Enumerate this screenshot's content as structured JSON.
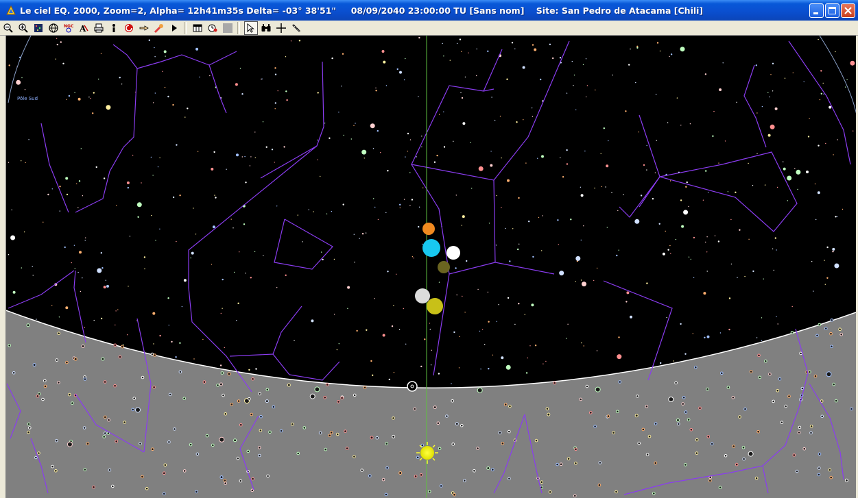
{
  "window": {
    "title": "Le ciel EQ. 2000, Zoom=2, Alpha= 12h41m35s Delta= -03° 38'51\"     08/09/2040 23:00:00 TU [Sans nom]    Site: San Pedro de Atacama [Chili]"
  },
  "toolbar": {
    "buttons": [
      "zoom-out-icon",
      "zoom-in-icon",
      "star-map-icon",
      "globe-icon",
      "ngc-icon",
      "text-label-icon",
      "print-icon",
      "info-icon",
      "reset-icon",
      "pointer-hand-icon",
      "comet-icon",
      "play-icon",
      "calendar-icon",
      "time-icon",
      "stop-icon",
      "arrow-cursor-icon",
      "binoculars-icon",
      "crosshair-icon",
      "measure-icon"
    ],
    "active": "arrow-cursor-icon"
  },
  "sky": {
    "pole_label": "Pôle Sud",
    "colors": {
      "sky": "#000000",
      "ground": "#808080",
      "lines": "#8a3cf0",
      "meridian": "#5ec040"
    }
  }
}
